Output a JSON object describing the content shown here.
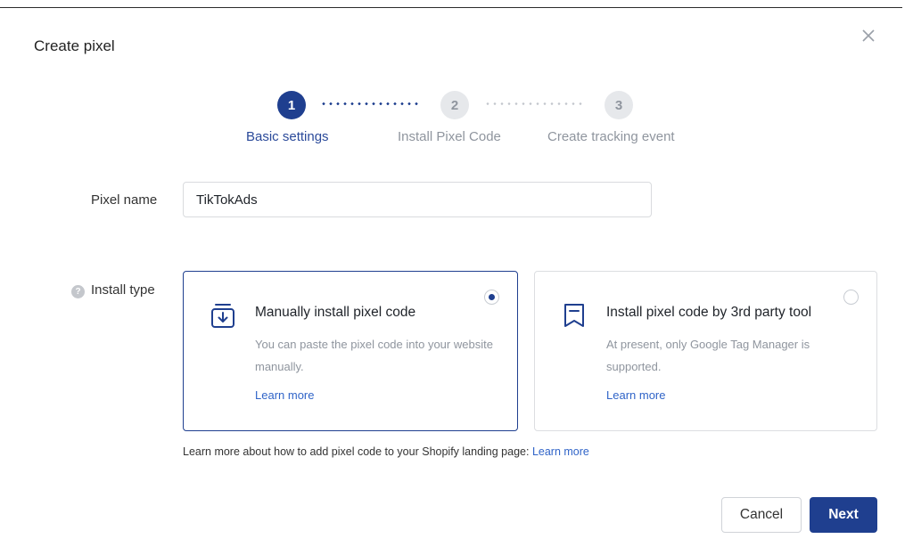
{
  "dialog": {
    "title": "Create pixel",
    "close_icon": "close-icon"
  },
  "stepper": {
    "steps": [
      {
        "number": "1",
        "label": "Basic settings",
        "state": "active"
      },
      {
        "number": "2",
        "label": "Install Pixel Code",
        "state": "pending"
      },
      {
        "number": "3",
        "label": "Create tracking event",
        "state": "pending"
      }
    ]
  },
  "form": {
    "pixel_name_label": "Pixel name",
    "pixel_name_value": "TikTokAds",
    "install_type_label": "Install type",
    "help_icon": "?",
    "options": [
      {
        "icon": "download-box-icon",
        "title": "Manually install pixel code",
        "description": "You can paste the pixel code into your website manually.",
        "link": "Learn more",
        "selected": true
      },
      {
        "icon": "bookmark-icon",
        "title": "Install pixel code by 3rd party tool",
        "description": "At present, only Google Tag Manager is supported.",
        "link": "Learn more",
        "selected": false
      }
    ],
    "note_text": "Learn more about how to add pixel code to your Shopify landing page: ",
    "note_link": "Learn more"
  },
  "footer": {
    "cancel_label": "Cancel",
    "next_label": "Next"
  },
  "colors": {
    "primary": "#1f3f8f",
    "link": "#3064c8",
    "muted": "#8f959e"
  }
}
